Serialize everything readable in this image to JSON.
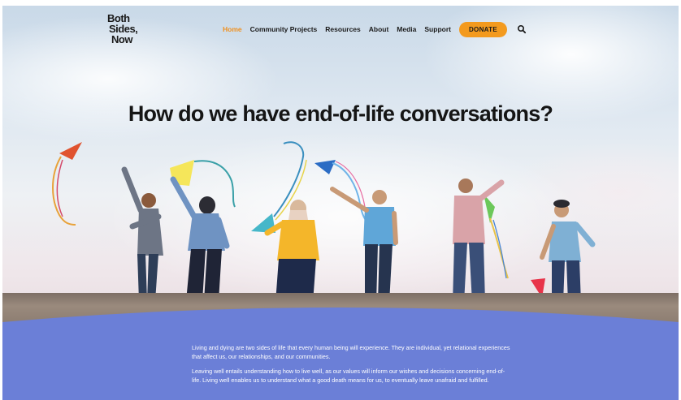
{
  "brand": {
    "logo_line1": "Both",
    "logo_line2": "Sides,",
    "logo_line3": "Now"
  },
  "nav": {
    "items": [
      {
        "label": "Home",
        "active": true
      },
      {
        "label": "Community Projects",
        "active": false
      },
      {
        "label": "Resources",
        "active": false
      },
      {
        "label": "About",
        "active": false
      },
      {
        "label": "Media",
        "active": false
      },
      {
        "label": "Support",
        "active": false
      }
    ],
    "donate_label": "DONATE",
    "search_icon": "search-icon"
  },
  "hero": {
    "title": "How do we have end-of-life conversations?"
  },
  "intro": {
    "paragraph1": "Living and dying are two sides of life that every human being will experience. They are individual, yet relational experiences that affect us, our relationships, and our communities.",
    "paragraph2": "Leaving well entails understanding how to live well, as our values will inform our wishes and decisions concerning end-of-life. Living well enables us to understand what a good death means for us, to eventually leave unafraid and fulfilled."
  },
  "colors": {
    "accent": "#f39a1e",
    "section_bg": "#6b7fd7",
    "text_dark": "#1a1a1a"
  }
}
